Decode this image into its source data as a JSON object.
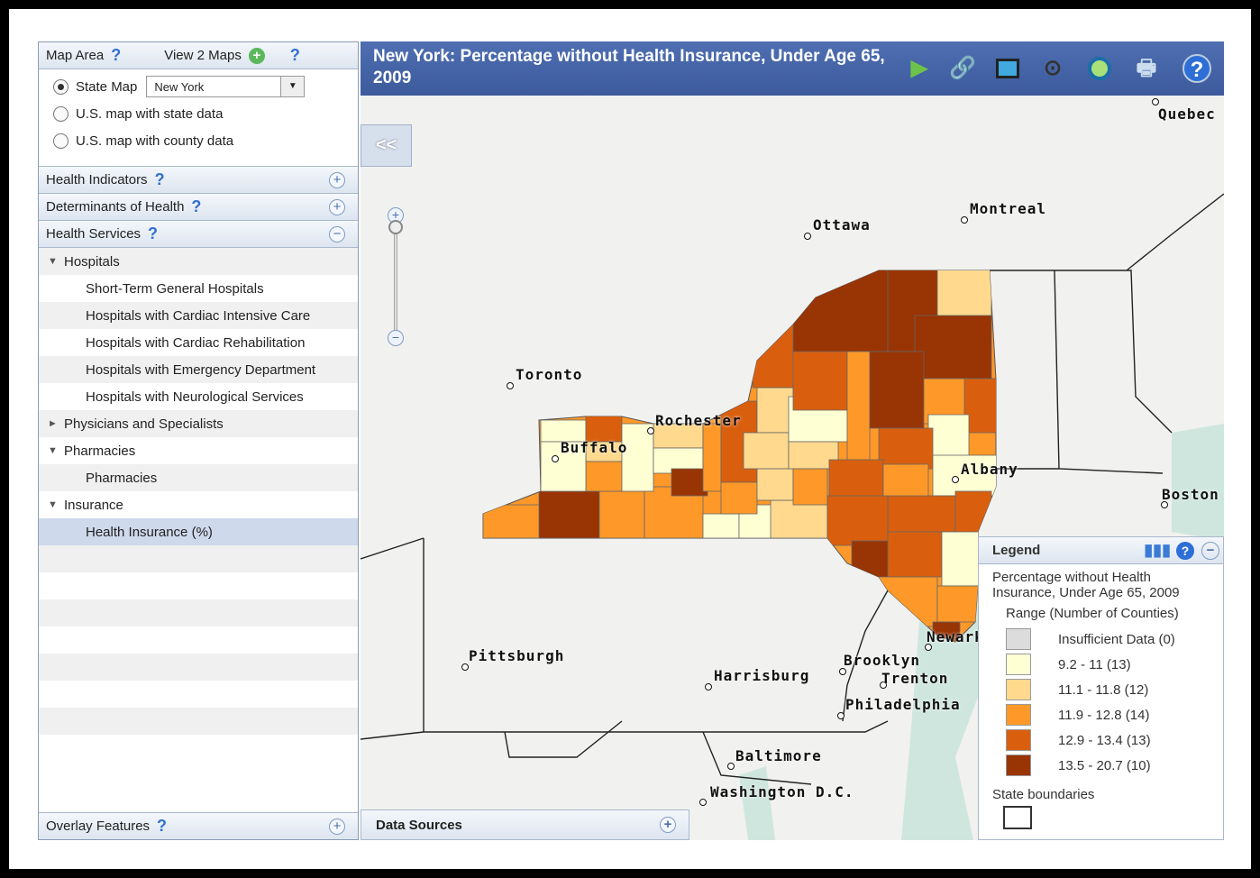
{
  "left_panel": {
    "map_area": {
      "label": "Map Area",
      "help": "?",
      "view2_label": "View 2 Maps",
      "view2_icon": "plus-circle-icon",
      "help2": "?"
    },
    "radios": [
      {
        "label": "State Map",
        "selected": true
      },
      {
        "label": "U.S. map with state data",
        "selected": false
      },
      {
        "label": "U.S. map with county data",
        "selected": false
      }
    ],
    "state_select": "New York",
    "sections": [
      {
        "label": "Health Indicators",
        "help": "?",
        "toggle": "+"
      },
      {
        "label": "Determinants of Health",
        "help": "?",
        "toggle": "+"
      },
      {
        "label": "Health Services",
        "help": "?",
        "toggle": "−"
      }
    ],
    "tree": [
      {
        "label": "Hospitals",
        "level": 1,
        "expander": "▼"
      },
      {
        "label": "Short-Term General Hospitals",
        "level": 2
      },
      {
        "label": "Hospitals with Cardiac Intensive Care",
        "level": 2
      },
      {
        "label": "Hospitals with Cardiac Rehabilitation",
        "level": 2
      },
      {
        "label": "Hospitals with Emergency Department",
        "level": 2
      },
      {
        "label": "Hospitals with Neurological Services",
        "level": 2
      },
      {
        "label": "Physicians and Specialists",
        "level": 1,
        "expander": "►"
      },
      {
        "label": "Pharmacies",
        "level": 1,
        "expander": "▼"
      },
      {
        "label": "Pharmacies",
        "level": 2
      },
      {
        "label": "Insurance",
        "level": 1,
        "expander": "▼"
      },
      {
        "label": "Health Insurance (%)",
        "level": 2,
        "selected": true
      }
    ],
    "overlay": {
      "label": "Overlay Features",
      "help": "?",
      "toggle": "+"
    }
  },
  "map": {
    "title": "New York: Percentage without Health Insurance, Under Age 65, 2009",
    "toolbar": [
      "play-icon",
      "link-icon",
      "screen-icon",
      "binoculars-icon",
      "magnifier-icon",
      "print-icon",
      "help-icon"
    ],
    "collapse_label": "<<",
    "zoom": {
      "in": "+",
      "out": "−"
    },
    "cities": [
      "Quebec",
      "Montreal",
      "Ottawa",
      "Toronto",
      "Rochester",
      "Buffalo",
      "Albany",
      "Boston",
      "Pittsburgh",
      "Harrisburg",
      "Brooklyn",
      "Newark",
      "Trenton",
      "Philadelphia",
      "Baltimore",
      "Washington D.C."
    ],
    "data_sources": {
      "label": "Data Sources",
      "toggle": "+"
    }
  },
  "legend": {
    "title": "Legend",
    "subtitle": "Percentage without Health Insurance, Under Age 65, 2009",
    "range_header": "Range (Number of Counties)",
    "items": [
      {
        "label": "Insufficient Data (0)",
        "color": "#dcdcdc"
      },
      {
        "label": "9.2 - 11 (13)",
        "color": "#ffffd4"
      },
      {
        "label": "11.1 - 11.8 (12)",
        "color": "#fed98e"
      },
      {
        "label": "11.9 - 12.8 (14)",
        "color": "#fe9929"
      },
      {
        "label": "12.9 - 13.4 (13)",
        "color": "#d95f0e"
      },
      {
        "label": "13.5 - 20.7 (10)",
        "color": "#993404"
      }
    ],
    "boundaries_label": "State boundaries"
  }
}
